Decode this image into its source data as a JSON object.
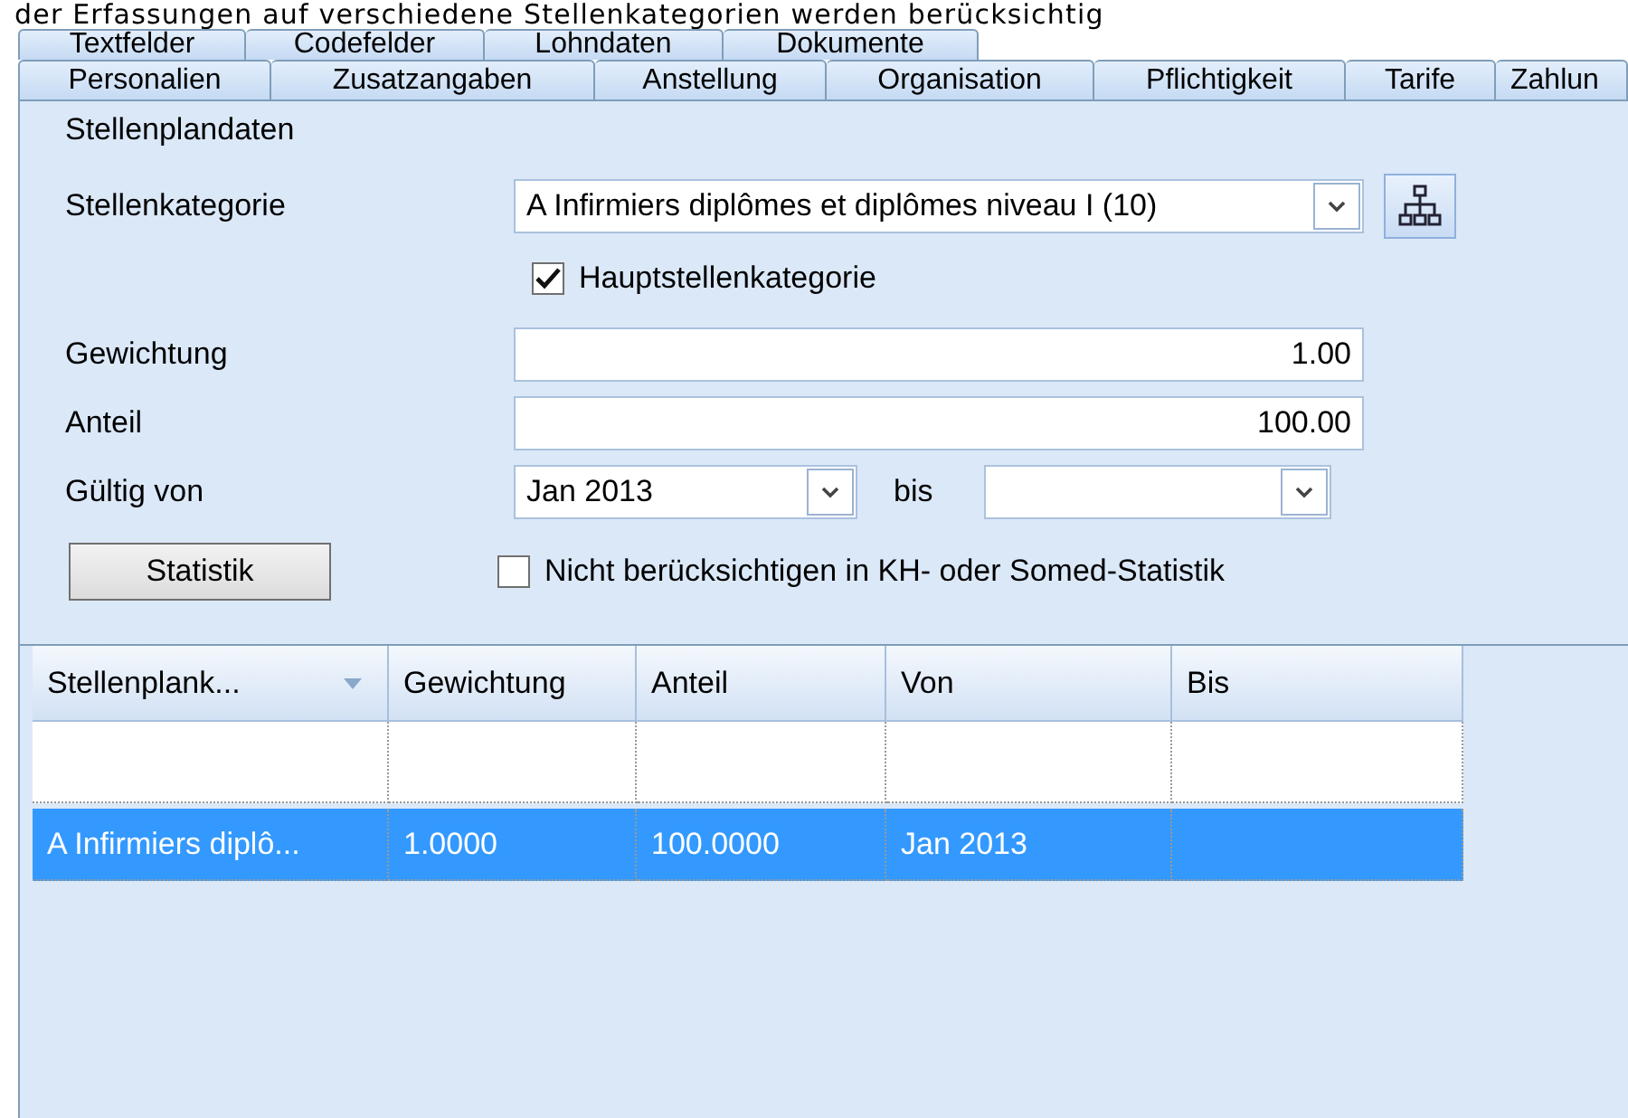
{
  "caption": "der Erfassungen auf verschiedene Stellenkategorien werden berücksichtig",
  "tab_rows": [
    [
      {
        "label": "Textfelder",
        "selected": false
      },
      {
        "label": "Codefelder",
        "selected": false
      },
      {
        "label": "Lohndaten",
        "selected": false
      },
      {
        "label": "Dokumente",
        "selected": false
      }
    ],
    [
      {
        "label": "Personalien",
        "selected": false
      },
      {
        "label": "Zusatzangaben",
        "selected": false
      },
      {
        "label": "Anstellung",
        "selected": false
      },
      {
        "label": "Organisation",
        "selected": false
      },
      {
        "label": "Pflichtigkeit",
        "selected": false
      },
      {
        "label": "Tarife",
        "selected": false
      },
      {
        "label": "Zahlun",
        "selected": false
      }
    ]
  ],
  "group": {
    "title": "Stellenplandaten"
  },
  "category": {
    "label": "Stellenkategorie",
    "value": "A Infirmiers diplômes et diplômes niveau I (10)"
  },
  "main_category": {
    "label": "Hauptstellenkategorie",
    "checked": true
  },
  "weight": {
    "label": "Gewichtung",
    "value": "1.00"
  },
  "share": {
    "label": "Anteil",
    "value": "100.00"
  },
  "valid": {
    "label": "Gültig von",
    "from": "Jan 2013",
    "to_label": "bis"
  },
  "statistics_button": "Statistik",
  "exclude": {
    "label": "Nicht berücksichtigen in KH- oder Somed-Statistik",
    "checked": false
  },
  "grid": {
    "columns": [
      "Stellenplank...",
      "Gewichtung",
      "Anteil",
      "Von",
      "Bis"
    ],
    "rows": [
      {
        "selected": false
      },
      {
        "selected": true,
        "cells": [
          "A Infirmiers diplô...",
          "1.0000",
          "100.0000",
          "Jan 2013"
        ]
      }
    ]
  }
}
